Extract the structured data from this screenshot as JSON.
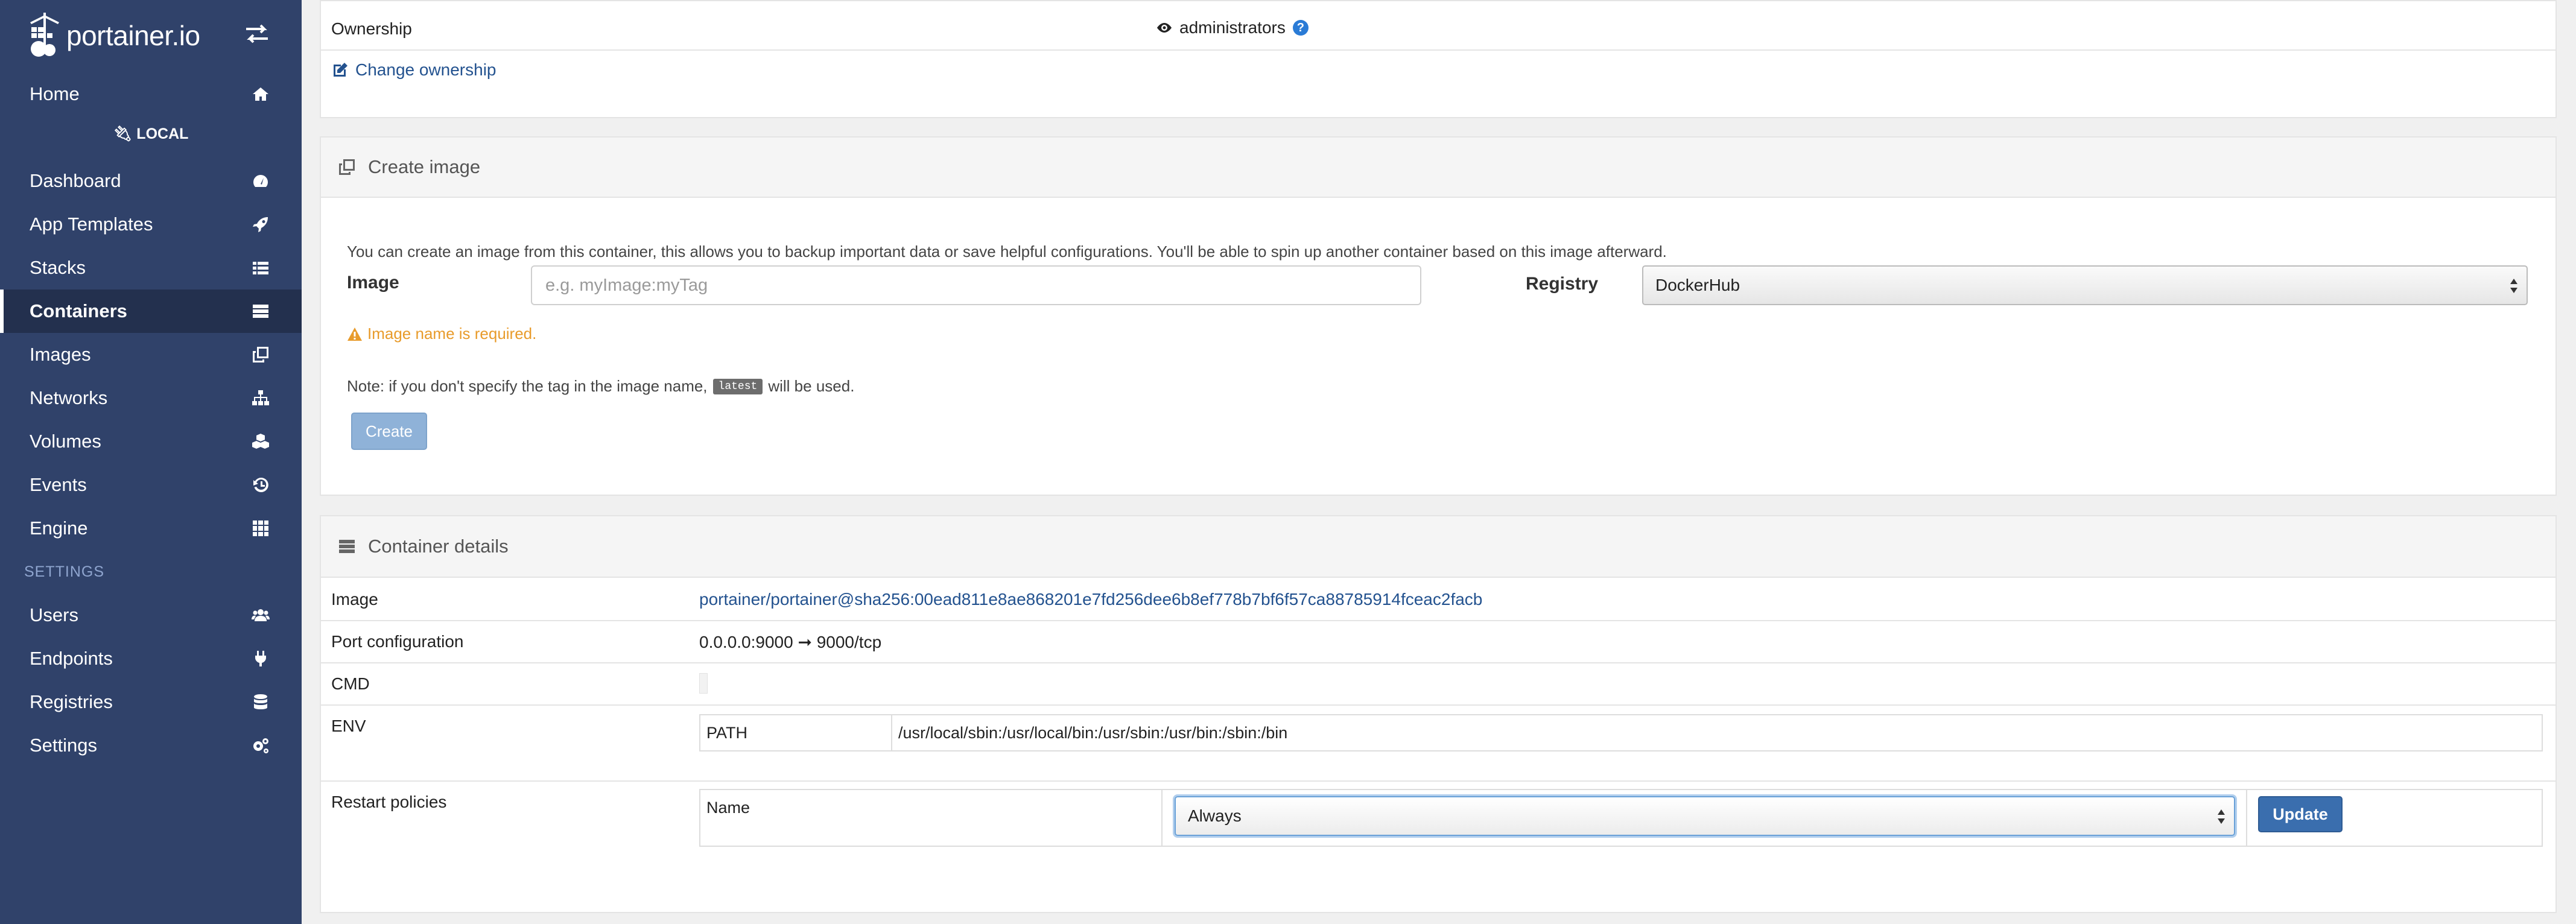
{
  "brand": {
    "logo_text": "portainer.io"
  },
  "sidebar": {
    "home": "Home",
    "endpoint_label": "LOCAL",
    "items": [
      {
        "label": "Dashboard",
        "icon": "tachometer-icon"
      },
      {
        "label": "App Templates",
        "icon": "rocket-icon"
      },
      {
        "label": "Stacks",
        "icon": "list-icon"
      },
      {
        "label": "Containers",
        "icon": "server-icon",
        "active": true
      },
      {
        "label": "Images",
        "icon": "clone-icon"
      },
      {
        "label": "Networks",
        "icon": "sitemap-icon"
      },
      {
        "label": "Volumes",
        "icon": "cubes-icon"
      },
      {
        "label": "Events",
        "icon": "history-icon"
      },
      {
        "label": "Engine",
        "icon": "th-icon"
      }
    ],
    "settings_heading": "SETTINGS",
    "settings_items": [
      {
        "label": "Users",
        "icon": "users-icon"
      },
      {
        "label": "Endpoints",
        "icon": "plug-icon"
      },
      {
        "label": "Registries",
        "icon": "database-icon"
      },
      {
        "label": "Settings",
        "icon": "cogs-icon"
      }
    ]
  },
  "ownership": {
    "label": "Ownership",
    "value": "administrators",
    "change_link": "Change ownership"
  },
  "create_image": {
    "title": "Create image",
    "hint": "You can create an image from this container, this allows you to backup important data or save helpful configurations. You'll be able to spin up another container based on this image afterward.",
    "image_label": "Image",
    "image_placeholder": "e.g. myImage:myTag",
    "image_value": "",
    "registry_label": "Registry",
    "registry_value": "DockerHub",
    "warning": "Image name is required.",
    "note_before": "Note: if you don't specify the tag in the image name,",
    "note_tag": "latest",
    "note_after": "will be used.",
    "create_button": "Create"
  },
  "container_details": {
    "title": "Container details",
    "image_label": "Image",
    "image_value": "portainer/portainer@sha256:00ead811e8ae868201e7fd256dee6b8ef778b7bf6f57ca88785914fceac2facb",
    "port_label": "Port configuration",
    "port_value": "0.0.0.0:9000 ➞ 9000/tcp",
    "cmd_label": "CMD",
    "cmd_value": "",
    "env_label": "ENV",
    "env_rows": [
      {
        "key": "PATH",
        "value": "/usr/local/sbin:/usr/local/bin:/usr/sbin:/usr/bin:/sbin:/bin"
      }
    ],
    "restart_label": "Restart policies",
    "restart_name_label": "Name",
    "restart_value": "Always",
    "update_button": "Update"
  },
  "colors": {
    "sidebar_bg": "#30426a",
    "sidebar_active_bg": "#23304e",
    "link": "#23528f",
    "warning": "#e89b2b",
    "primary_button": "#3a6eae"
  }
}
